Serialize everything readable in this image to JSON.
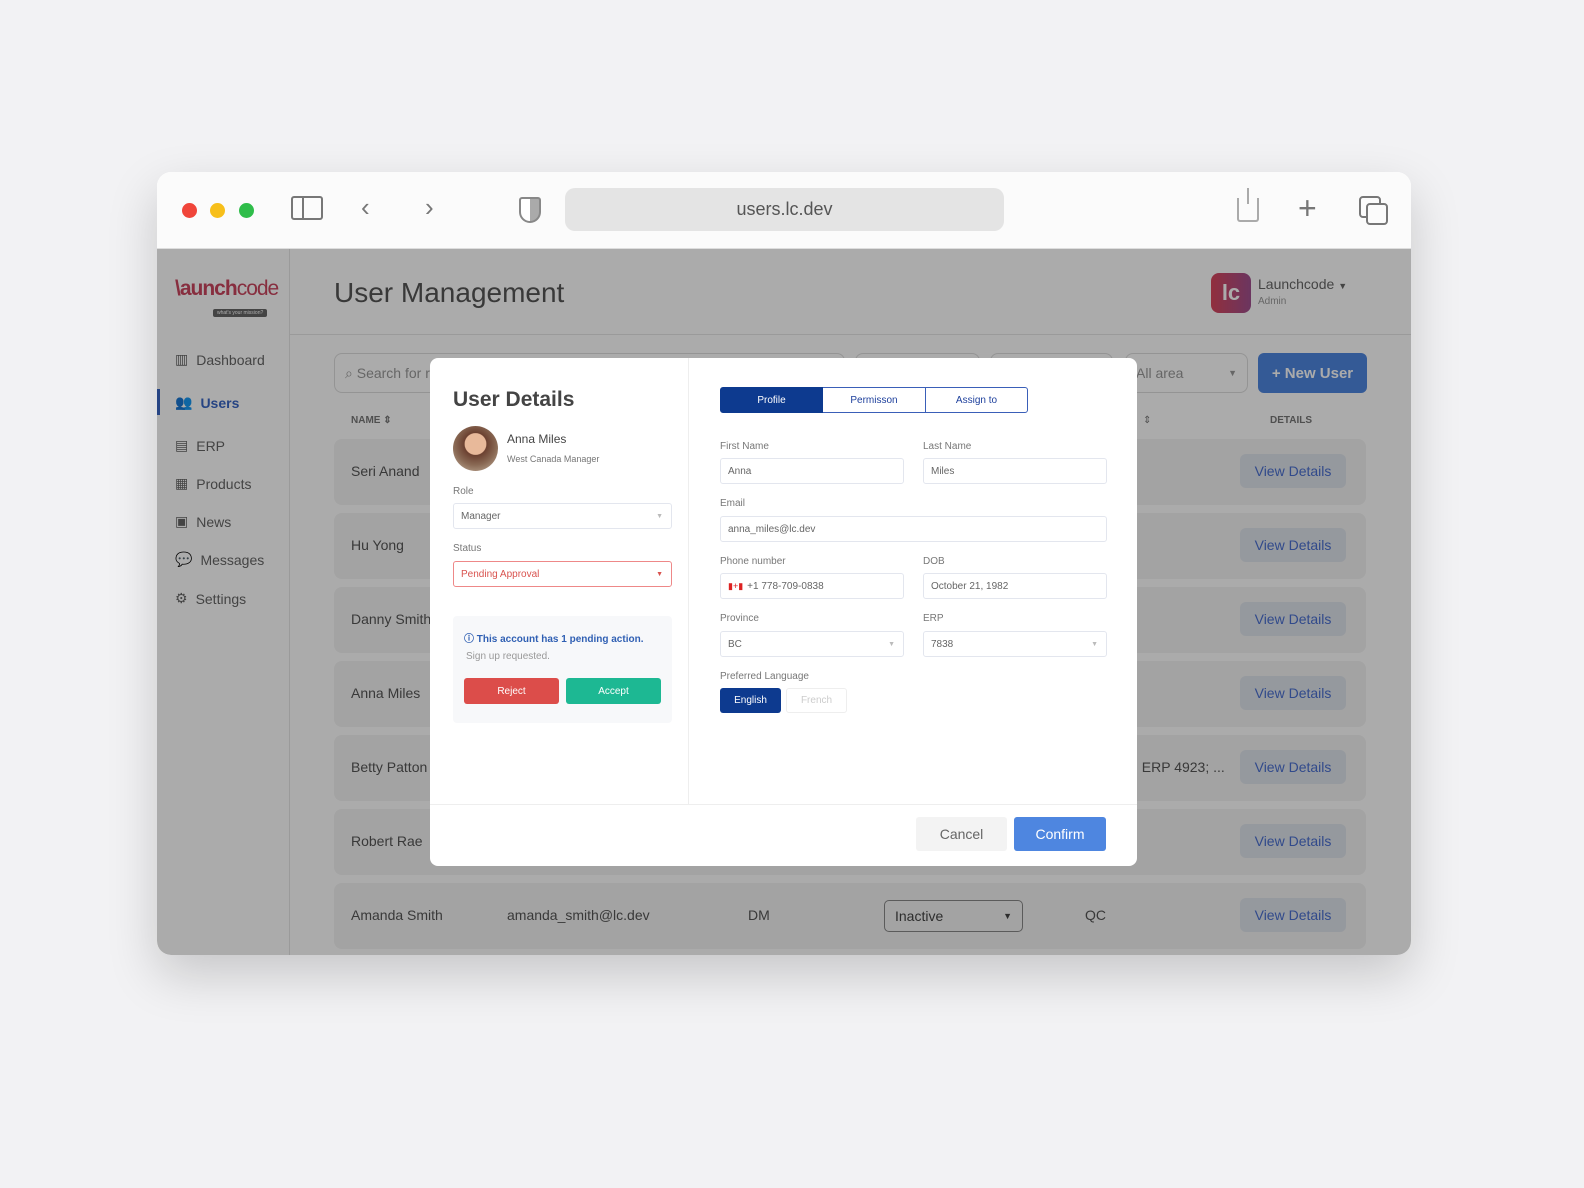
{
  "browser": {
    "url": "users.lc.dev"
  },
  "app": {
    "logo": "launchcode",
    "logo_tagline": "what's your mission?",
    "page_title": "User Management",
    "account": {
      "name": "Launchcode",
      "role": "Admin",
      "initials": "lc"
    },
    "sidebar": [
      {
        "label": "Dashboard",
        "icon": "▥"
      },
      {
        "label": "Users",
        "icon": "👥"
      },
      {
        "label": "ERP",
        "icon": "▤"
      },
      {
        "label": "Products",
        "icon": "▦"
      },
      {
        "label": "News",
        "icon": "▣"
      },
      {
        "label": "Messages",
        "icon": "💬"
      },
      {
        "label": "Settings",
        "icon": "⚙"
      }
    ],
    "search_placeholder": "Search for r",
    "area_filter": "All area",
    "new_user": "+ New User",
    "columns": {
      "name": "NAME ⇕",
      "sort": "⇕",
      "details": "DETAILS"
    },
    "rows": [
      {
        "name": "Seri Anand"
      },
      {
        "name": "Hu Yong"
      },
      {
        "name": "Danny Smith"
      },
      {
        "name": "Anna Miles"
      },
      {
        "name": "Betty Patton",
        "extra": "; ERP 4923; ..."
      },
      {
        "name": "Robert Rae"
      },
      {
        "name": "Amanda Smith",
        "email": "amanda_smith@lc.dev",
        "role": "DM",
        "status": "Inactive",
        "area": "QC"
      }
    ],
    "view_details": "View Details"
  },
  "modal": {
    "title": "User Details",
    "user": {
      "name": "Anna Miles",
      "subtitle": "West Canada Manager"
    },
    "role_label": "Role",
    "role": "Manager",
    "status_label": "Status",
    "status": "Pending Approval",
    "notice": "This account has 1 pending action.",
    "notice_detail": "Sign up requested.",
    "reject": "Reject",
    "accept": "Accept",
    "tabs": [
      "Profile",
      "Permisson",
      "Assign to"
    ],
    "fields": {
      "first_name_label": "First Name",
      "first_name": "Anna",
      "last_name_label": "Last Name",
      "last_name": "Miles",
      "email_label": "Email",
      "email": "anna_miles@lc.dev",
      "phone_label": "Phone number",
      "phone": "+1 778-709-0838",
      "dob_label": "DOB",
      "dob": "October 21, 1982",
      "province_label": "Province",
      "province": "BC",
      "erp_label": "ERP",
      "erp": "7838",
      "lang_label": "Preferred Language",
      "lang_options": [
        "English",
        "French"
      ]
    },
    "cancel": "Cancel",
    "confirm": "Confirm"
  },
  "colors": {
    "primary": "#0d3a8f",
    "confirm": "#4e86e0",
    "reject": "#dc4d4a",
    "accept": "#1db893",
    "brand": "#c9455e"
  }
}
